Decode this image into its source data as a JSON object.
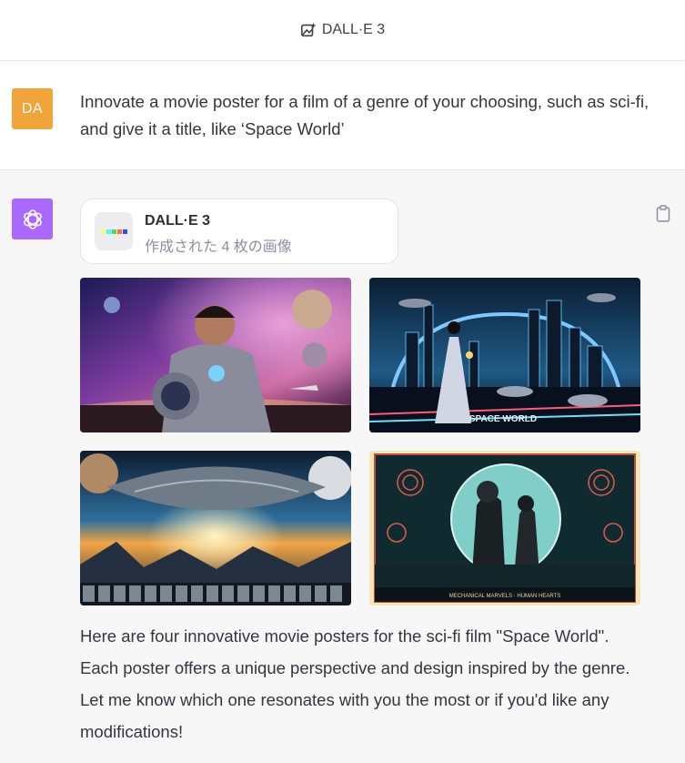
{
  "header": {
    "title": "DALL·E 3",
    "icon": "image-sparkle-icon"
  },
  "user_message": {
    "avatar": "DA",
    "avatar_color": "#f0a43a",
    "text": "Innovate a movie poster for a film of a genre of your choosing, such as sci-fi, and give it a title, like ‘Space World’"
  },
  "assistant_message": {
    "avatar_color": "#ab68ff",
    "avatar_icon": "openai-logo-icon",
    "tool": {
      "name": "DALL·E 3",
      "status": "作成された 4 枚の画像"
    },
    "images": [
      {
        "name": "astronaut-poster"
      },
      {
        "name": "city-woman-poster",
        "caption": "SPACE WORLD"
      },
      {
        "name": "spaceship-poster"
      },
      {
        "name": "mechanical-poster",
        "caption": "MECHANICAL MARVELS · HUMAN HEARTS"
      }
    ],
    "text": "Here are four innovative movie posters for the sci-fi film \"Space World\". Each poster offers a unique perspective and design inspired by the genre. Let me know which one resonates with you the most or if you'd like any modifications!",
    "copy_icon": "clipboard-icon"
  }
}
